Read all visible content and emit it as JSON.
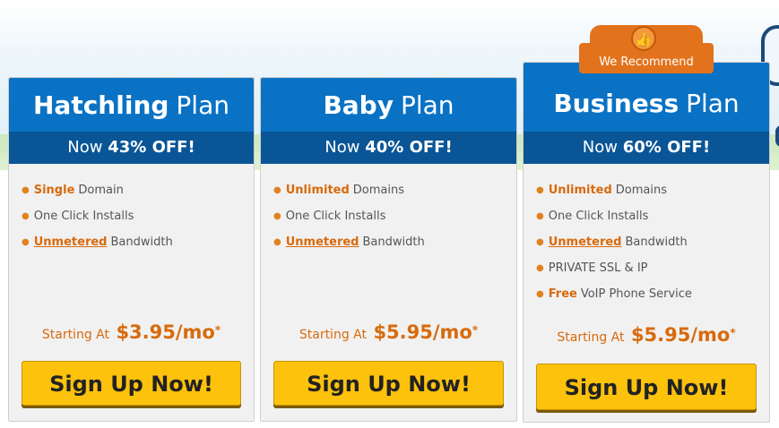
{
  "plans": [
    {
      "name": "Hatchling",
      "plan_word": "Plan",
      "discount_prefix": "Now",
      "discount": "43% OFF!",
      "features": [
        {
          "highlight": "Single",
          "text": "Domain",
          "underline": false
        },
        {
          "highlight": "",
          "text": "One Click Installs",
          "underline": false
        },
        {
          "highlight": "Unmetered",
          "text": "Bandwidth",
          "underline": true
        }
      ],
      "price_label": "Starting At",
      "price": "$3.95/mo",
      "price_mark": "*",
      "cta": "Sign Up Now!"
    },
    {
      "name": "Baby",
      "plan_word": "Plan",
      "discount_prefix": "Now",
      "discount": "40% OFF!",
      "features": [
        {
          "highlight": "Unlimited",
          "text": "Domains",
          "underline": false
        },
        {
          "highlight": "",
          "text": "One Click Installs",
          "underline": false
        },
        {
          "highlight": "Unmetered",
          "text": "Bandwidth",
          "underline": true
        }
      ],
      "price_label": "Starting At",
      "price": "$5.95/mo",
      "price_mark": "*",
      "cta": "Sign Up Now!"
    },
    {
      "name": "Business",
      "plan_word": "Plan",
      "discount_prefix": "Now",
      "discount": "60% OFF!",
      "badge": "We Recommend",
      "features": [
        {
          "highlight": "Unlimited",
          "text": "Domains",
          "underline": false
        },
        {
          "highlight": "",
          "text": "One Click Installs",
          "underline": false
        },
        {
          "highlight": "Unmetered",
          "text": "Bandwidth",
          "underline": true
        },
        {
          "highlight": "",
          "text": "PRIVATE SSL & IP",
          "underline": false
        },
        {
          "highlight": "Free",
          "text": "VoIP Phone Service",
          "underline": false
        }
      ],
      "price_label": "Starting At",
      "price": "$5.95/mo",
      "price_mark": "*",
      "cta": "Sign Up Now!"
    }
  ],
  "colors": {
    "header_blue": "#0a72c4",
    "subheader_blue": "#0a5596",
    "accent_orange": "#d86a0c",
    "button_yellow": "#fdc20c"
  },
  "icons": {
    "bullet": "bullet-dot-icon",
    "badge": "thumbs-up-icon"
  }
}
